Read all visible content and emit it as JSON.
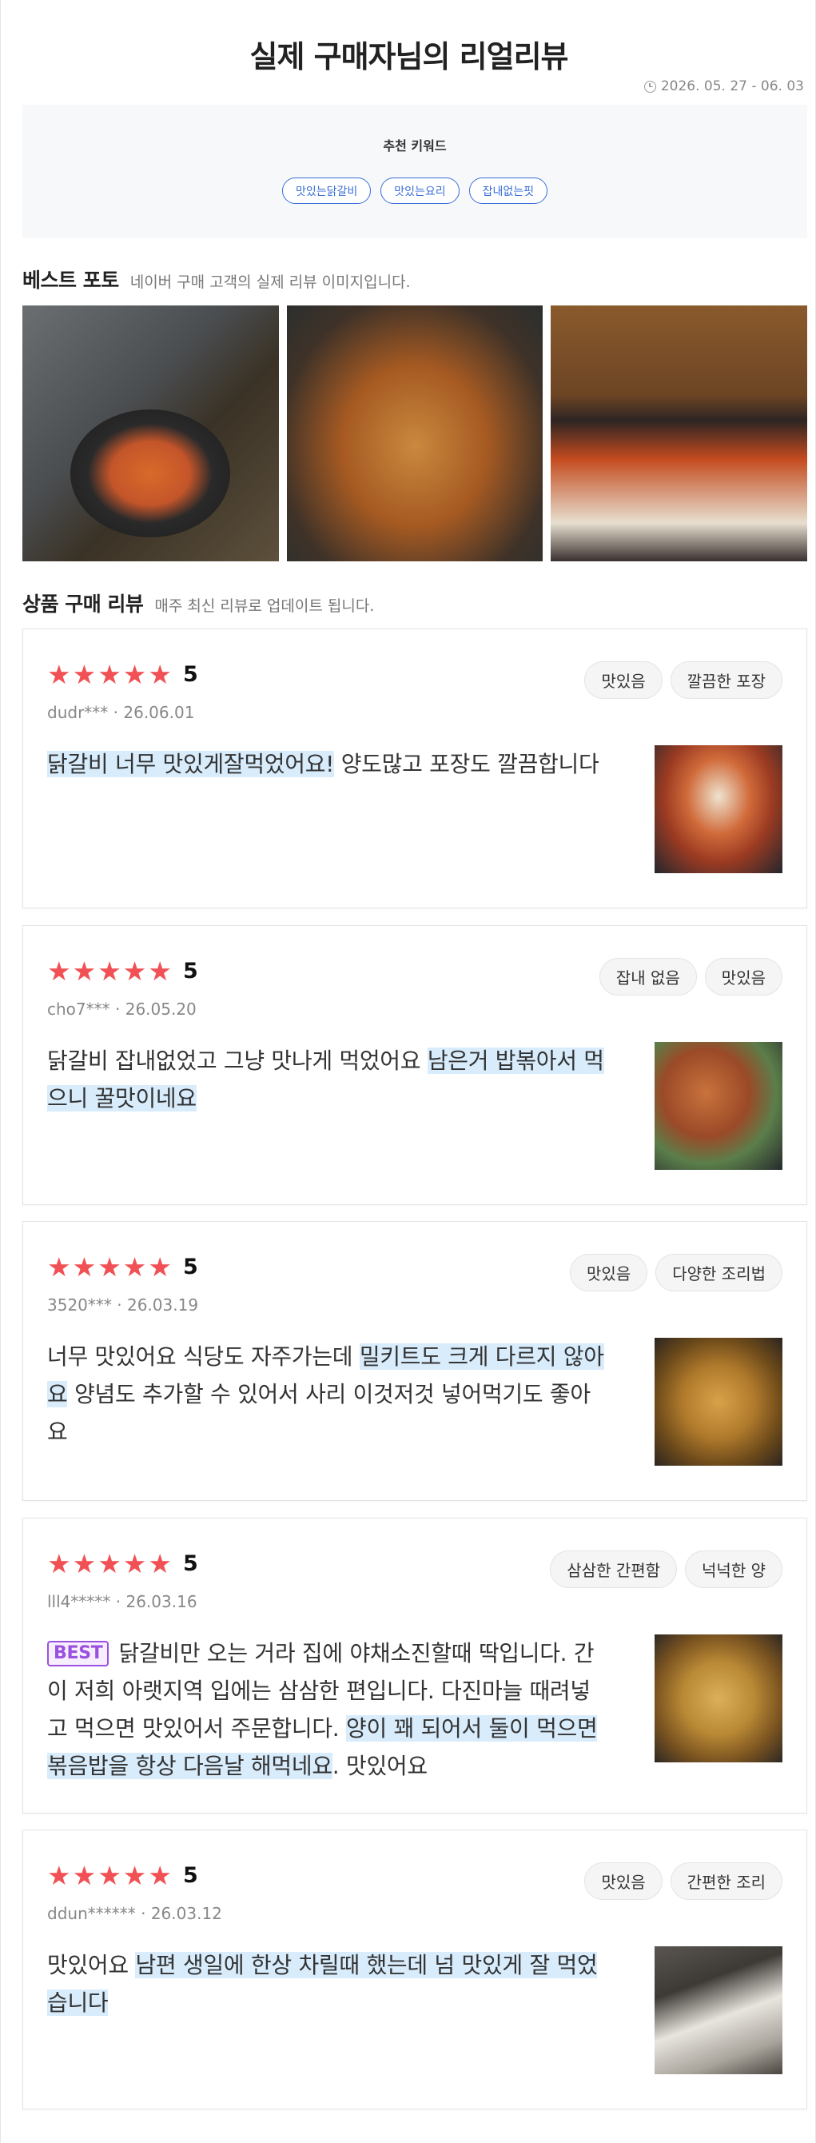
{
  "header": {
    "title": "실제 구매자님의 리얼리뷰",
    "period": "2026. 05. 27 - 06. 03"
  },
  "keywords": {
    "title": "추천 키워드",
    "items": [
      "맛있는닭갈비",
      "맛있는요리",
      "잡내없는핏"
    ]
  },
  "best_photo": {
    "title": "베스트 포토",
    "subtitle": "네이버 구매 고객의 실제 리뷰 이미지입니다."
  },
  "reviews_section": {
    "title": "상품 구매 리뷰",
    "subtitle": "매주 최신 리뷰로 업데이트 됩니다."
  },
  "reviews": [
    {
      "score": "5",
      "user": "dudr***",
      "date": "26.06.01",
      "tags": [
        "맛있음",
        "깔끔한 포장"
      ],
      "best_label": "",
      "segments": [
        {
          "text": "닭갈비 너무 맛있게잘먹었어요!",
          "hl": true
        },
        {
          "text": " 양도많고 포장도 깔끔합니다",
          "hl": false
        }
      ]
    },
    {
      "score": "5",
      "user": "cho7***",
      "date": "26.05.20",
      "tags": [
        "잡내 없음",
        "맛있음"
      ],
      "best_label": "",
      "segments": [
        {
          "text": "닭갈비 잡내없었고 그냥 맛나게 먹었어요 ",
          "hl": false
        },
        {
          "text": "남은거 밥볶아서 먹으니 꿀맛이네요",
          "hl": true
        }
      ]
    },
    {
      "score": "5",
      "user": "3520***",
      "date": "26.03.19",
      "tags": [
        "맛있음",
        "다양한 조리법"
      ],
      "best_label": "",
      "segments": [
        {
          "text": "너무 맛있어요 식당도 자주가는데 ",
          "hl": false
        },
        {
          "text": "밀키트도 크게 다르지 않아요",
          "hl": true
        },
        {
          "text": " 양념도 추가할 수 있어서 사리 이것저것 넣어먹기도 좋아요",
          "hl": false
        }
      ]
    },
    {
      "score": "5",
      "user": "lll4*****",
      "date": "26.03.16",
      "tags": [
        "삼삼한 간편함",
        "넉넉한 양"
      ],
      "best_label": "BEST",
      "segments": [
        {
          "text": "닭갈비만 오는 거라 집에 야채소진할때 딱입니다. 간이 저희 아랫지역 입에는 삼삼한 편입니다. 다진마늘 때려넣고 먹으면 맛있어서 주문합니다. ",
          "hl": false
        },
        {
          "text": "양이 꽤 되어서 둘이 먹으면 볶음밥을 항상 다음날 해먹네요",
          "hl": true
        },
        {
          "text": ". 맛있어요",
          "hl": false
        }
      ]
    },
    {
      "score": "5",
      "user": "ddun******",
      "date": "26.03.12",
      "tags": [
        "맛있음",
        "간편한 조리"
      ],
      "best_label": "",
      "segments": [
        {
          "text": "맛있어요 ",
          "hl": false
        },
        {
          "text": "남편 생일에 한상 차릴때 했는데 넘 맛있게 잘 먹었습니다",
          "hl": true
        }
      ]
    }
  ]
}
